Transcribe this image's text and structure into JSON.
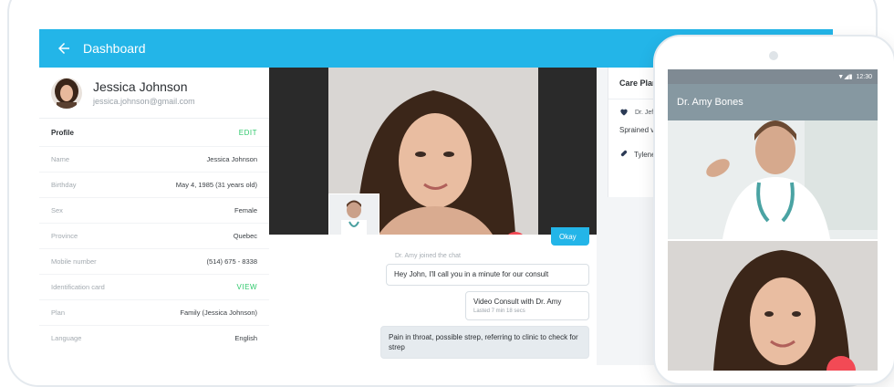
{
  "app": {
    "title": "Dashboard",
    "accent": "#23b5e8"
  },
  "patient": {
    "name": "Jessica Johnson",
    "email": "jessica.johnson@gmail.com",
    "profile_label": "Profile",
    "edit_label": "EDIT",
    "fields": [
      {
        "key": "Name",
        "value": "Jessica Johnson"
      },
      {
        "key": "Birthday",
        "value": "May 4, 1985 (31 years old)"
      },
      {
        "key": "Sex",
        "value": "Female"
      },
      {
        "key": "Province",
        "value": "Quebec"
      },
      {
        "key": "Mobile number",
        "value": "(514) 675 - 8338"
      },
      {
        "key": "Identification card",
        "value": "VIEW"
      },
      {
        "key": "Plan",
        "value": "Family (Jessica Johnson)"
      },
      {
        "key": "Language",
        "value": "English"
      }
    ]
  },
  "chat": {
    "okay": "Okay",
    "joined": "Dr. Amy joined the chat",
    "msg1": "Hey John, I'll call you in a minute for our consult",
    "msg2_title": "Video Consult with Dr. Amy",
    "msg2_sub": "Lasted 7 min 18 secs",
    "msg3": "Pain in throat, possible strep, referring to clinic to check for strep"
  },
  "care": {
    "title": "Care Plans",
    "item1": "Dr. Jef",
    "item1_sub": "Sprained v",
    "item2": "Tylene"
  },
  "phone": {
    "time": "12:30",
    "title": "Dr. Amy Bones"
  }
}
